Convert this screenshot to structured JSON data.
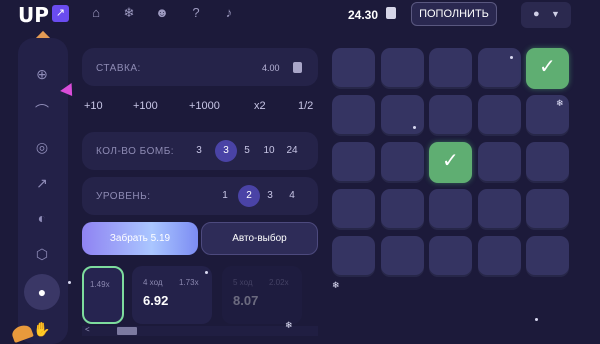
{
  "header": {
    "logo_text": "UP",
    "logo_arrow": "↗",
    "nav_icons": [
      "home-icon",
      "snowflake-icon",
      "users-icon",
      "help-icon",
      "microphone-icon"
    ],
    "balance": "24.30",
    "deposit_label": "ПОПОЛНИТЬ",
    "user_icon": "user-icon"
  },
  "sidebar": {
    "icons": [
      "crosshair-icon",
      "arc-icon",
      "target-icon",
      "chart-up-icon",
      "coin-icon",
      "cube-icon",
      "drop-icon",
      "hand-icon"
    ],
    "active": "drop-icon"
  },
  "controls": {
    "stake_label": "СТАВКА:",
    "stake_value": "4.00",
    "quick_bets": [
      "+10",
      "+100",
      "+1000",
      "x2",
      "1/2"
    ],
    "bombs_label": "КОЛ-ВО БОМБ:",
    "bombs_options": [
      "3",
      "3",
      "5",
      "10",
      "24"
    ],
    "bombs_selected_index": 1,
    "level_label": "УРОВЕНЬ:",
    "level_options": [
      "1",
      "2",
      "3",
      "4"
    ],
    "level_selected_index": 1,
    "take_label": "Забрать 5.19",
    "auto_label": "Авто-выбор"
  },
  "history": [
    {
      "multiplier": "1.49x",
      "move": "",
      "value": ""
    },
    {
      "move": "4 ход",
      "multiplier": "1.73x",
      "value": "6.92"
    },
    {
      "move": "5 ход",
      "multiplier": "2.02x",
      "value": "8.07"
    }
  ],
  "grid": {
    "rows": 5,
    "cols": 5,
    "wins": [
      [
        0,
        4
      ],
      [
        2,
        2
      ]
    ]
  },
  "colors": {
    "background": "#1c1a3a",
    "tile": "#353462",
    "tile_win": "#5fae72",
    "accent": "#6a4cf0"
  }
}
